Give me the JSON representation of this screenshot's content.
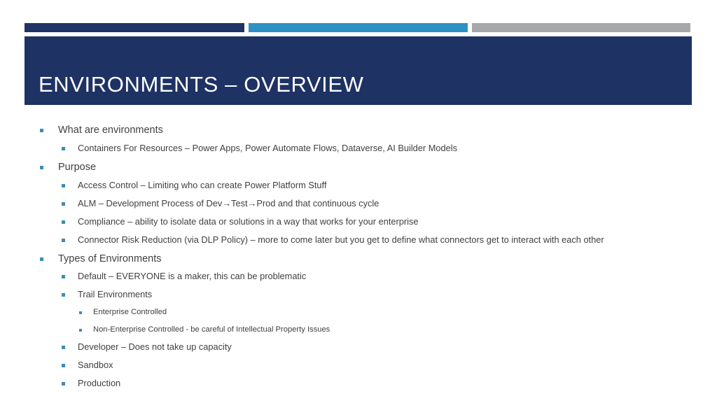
{
  "slide": {
    "title": "ENVIRONMENTS – OVERVIEW",
    "colors": {
      "title_bar": "#1E3263",
      "bar_navy": "#1F3364",
      "bar_blue": "#2E91C4",
      "bar_gray": "#A6A8AB",
      "bullet_marker": "#3E8CB5",
      "body_text": "#404040",
      "title_text": "#FFFFFF",
      "background": "#FFFFFF"
    }
  },
  "deco_bars": [
    {
      "name": "navy-bar",
      "color": "#1F3364"
    },
    {
      "name": "blue-bar",
      "color": "#2E91C4"
    },
    {
      "name": "gray-bar",
      "color": "#A6A8AB"
    }
  ],
  "bullets": [
    {
      "level": 1,
      "text": "What are environments"
    },
    {
      "level": 2,
      "text": "Containers For Resources – Power Apps, Power Automate Flows, Dataverse,  AI Builder Models"
    },
    {
      "level": 1,
      "text": "Purpose"
    },
    {
      "level": 2,
      "text": "Access Control – Limiting who can create Power Platform Stuff"
    },
    {
      "level": 2,
      "text": "ALM – Development Process of  Dev→Test→Prod and that continuous cycle"
    },
    {
      "level": 2,
      "text": "Compliance – ability to isolate data or solutions in a way that works for your enterprise"
    },
    {
      "level": 2,
      "text": "Connector Risk Reduction (via DLP Policy) – more to come later but you get to define what connectors get to interact with each other"
    },
    {
      "level": 1,
      "text": "Types of Environments"
    },
    {
      "level": 2,
      "text": "Default – EVERYONE is a maker, this can be problematic"
    },
    {
      "level": 2,
      "text": "Trail Environments"
    },
    {
      "level": 3,
      "text": "Enterprise Controlled"
    },
    {
      "level": 3,
      "text": "Non-Enterprise Controlled   - be careful of Intellectual Property Issues"
    },
    {
      "level": 2,
      "text": "Developer – Does not take up capacity"
    },
    {
      "level": 2,
      "text": "Sandbox"
    },
    {
      "level": 2,
      "text": "Production"
    }
  ]
}
